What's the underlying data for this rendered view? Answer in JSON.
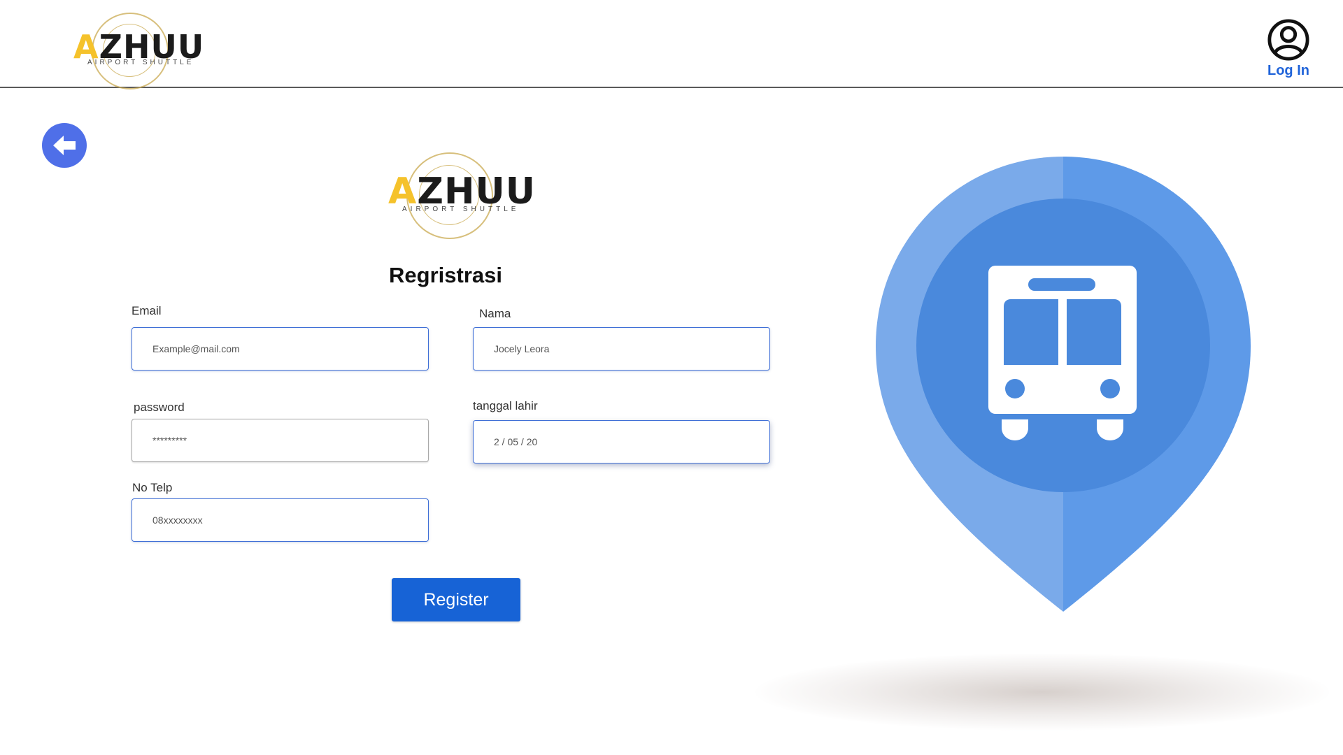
{
  "header": {
    "logo": {
      "letter_a": "A",
      "letters_rest": "ZHUU",
      "tagline": "AIRPORT SHUTTLE"
    },
    "login_label": "Log In",
    "login_icon": "user-circle-icon"
  },
  "back_icon": "arrow-left-icon",
  "main_logo": {
    "letter_a": "A",
    "letters_rest": "ZHUU",
    "tagline": "AIRPORT SHUTTLE"
  },
  "form": {
    "title": "Regristrasi",
    "fields": {
      "email": {
        "label": "Email",
        "value": "Example@mail.com"
      },
      "nama": {
        "label": "Nama",
        "value": "Jocely Leora"
      },
      "password": {
        "label": "password",
        "value": "*********"
      },
      "tanggal_lahir": {
        "label": "tanggal lahir",
        "value": "2 / 05 / 20"
      },
      "no_telp": {
        "label": "No Telp",
        "value": "08xxxxxxxx"
      }
    },
    "register_label": "Register"
  },
  "illustration": {
    "icon": "bus-location-pin-icon",
    "colors": {
      "pin_left": "#7aaaea",
      "pin_right": "#5e9ae8",
      "inner_circle": "#4a89dc",
      "bus": "#ffffff"
    }
  },
  "colors": {
    "accent_blue": "#1763d6",
    "back_button": "#4f6fe8",
    "logo_yellow": "#f5c22b"
  }
}
